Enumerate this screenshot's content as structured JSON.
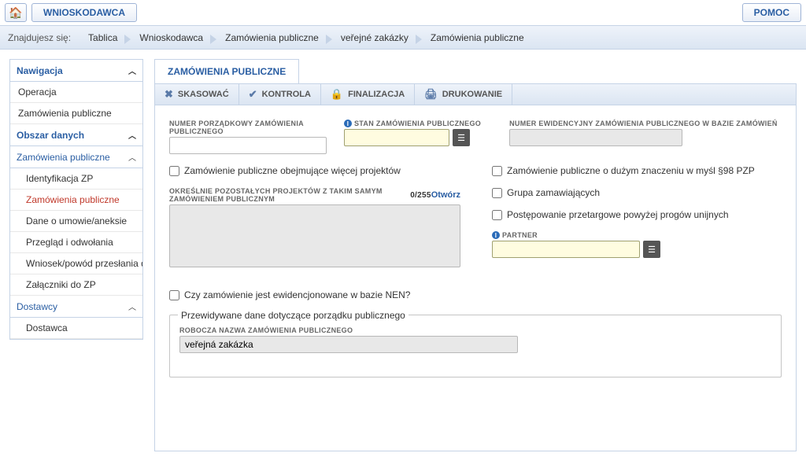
{
  "topbar": {
    "applicant": "WNIOSKODAWCA",
    "help": "POMOC"
  },
  "breadcrumb": {
    "label": "Znajdujesz się:",
    "items": [
      "Tablica",
      "Wnioskodawca",
      "Zamówienia publiczne",
      "veřejné zakázky",
      "Zamówienia publiczne"
    ]
  },
  "sidebar": {
    "nav_label": "Nawigacja",
    "items_a": [
      "Operacja",
      "Zamówienia publiczne"
    ],
    "data_area": "Obszar danych",
    "zp_section": "Zamówienia publiczne",
    "zp_items": [
      "Identyfikacja ZP",
      "Zamówienia publiczne",
      "Dane o umowie/aneksie",
      "Przegląd i odwołania",
      "Wniosek/powód przesłania do UOł",
      "Załączniki do ZP"
    ],
    "suppliers": "Dostawcy",
    "supplier_item": "Dostawca"
  },
  "tab": {
    "title": "ZAMÓWIENIA PUBLICZNE"
  },
  "toolbar": {
    "delete": "SKASOWAĆ",
    "control": "KONTROLA",
    "finalize": "FINALIZACJA",
    "print": "DRUKOWANIE"
  },
  "form": {
    "f1_label": "NUMER PORZĄDKOWY ZAMÓWIENIA PUBLICZNEGO",
    "f2_label": "STAN ZAMÓWIENIA PUBLICZNEGO",
    "f3_label": "NUMER EWIDENCYJNY ZAMÓWIENIA PUBLICZNEGO W BAZIE ZAMÓWIEŃ",
    "chk_more_projects": "Zamówienie publiczne obejmujące więcej projektów",
    "chk_big_importance": "Zamówienie publiczne o dużym znaczeniu w myśl §98 PZP",
    "other_projects_label": "OKREŚLNIE POZOSTAŁYCH PROJEKTÓW Z TAKIM SAMYM ZAMÓWIENIEM PUBLICZNYM",
    "pos": "0/255",
    "open": "Otwórz",
    "chk_group": "Grupa zamawiających",
    "chk_tender_above": "Postępowanie przetargowe powyżej progów unijnych",
    "partner_label": "PARTNER",
    "chk_nen": "Czy zamówienie jest ewidencjonowane w bazie NEN?",
    "fieldset_legend": "Przewidywane dane dotyczące porządku publicznego",
    "working_name_label": "ROBOCZA NAZWA ZAMÓWIENIA PUBLICZNEGO",
    "working_name_value": "veřejná zakázka"
  }
}
